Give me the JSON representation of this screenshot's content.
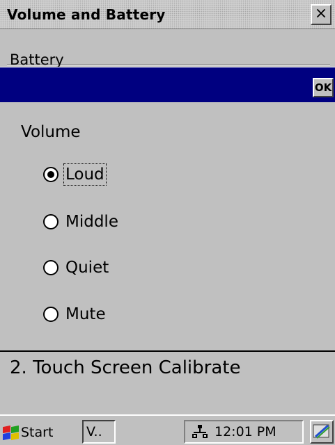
{
  "window": {
    "title": "Volume and Battery",
    "close_label": "×"
  },
  "battery": {
    "label": "Battery"
  },
  "dialog": {
    "ok_label": "OK",
    "volume_label": "Volume",
    "options": [
      {
        "label": "Loud",
        "checked": true
      },
      {
        "label": "Middle",
        "checked": false
      },
      {
        "label": "Quiet",
        "checked": false
      },
      {
        "label": "Mute",
        "checked": false
      }
    ]
  },
  "background": {
    "calibrate_text": "2. Touch Screen Calibrate"
  },
  "taskbar": {
    "start_label": "Start",
    "task_label": "V..",
    "clock": "12:01 PM",
    "tray_icon": "network-icon",
    "desktop_icon": "desktop-icon"
  },
  "colors": {
    "dialog_titlebar": "#000080",
    "face": "#c0c0c0"
  }
}
